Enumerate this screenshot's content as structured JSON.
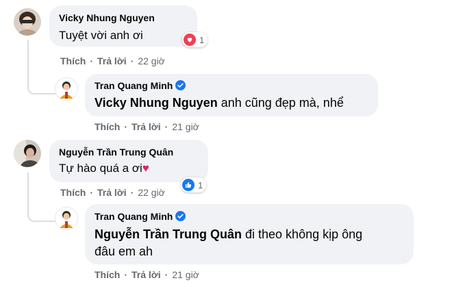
{
  "colors": {
    "bubble": "#f0f2f5",
    "meta": "#65676b",
    "verified": "#1877f2",
    "love": "#f33e58",
    "like": "#1877f2"
  },
  "comments": [
    {
      "author": "Vicky Nhung Nguyen",
      "text": "Tuyệt vời anh ơi",
      "reaction": {
        "icon": "heart-icon",
        "count": "1"
      },
      "actions": {
        "like": "Thích",
        "reply": "Trả lời",
        "time": "22 giờ"
      }
    },
    {
      "author": "Tran Quang Minh",
      "verified": true,
      "mention": "Vicky Nhung Nguyen",
      "text": " anh cũng đẹp mà, nhể",
      "actions": {
        "like": "Thích",
        "reply": "Trả lời",
        "time": "21 giờ"
      }
    },
    {
      "author": "Nguyễn Trần Trung Quân",
      "text": "Tự hào quá a ơi",
      "text_emoji": "♥",
      "reaction": {
        "icon": "thumbs-up-icon",
        "count": "1"
      },
      "actions": {
        "like": "Thích",
        "reply": "Trả lời",
        "time": "22 giờ"
      }
    },
    {
      "author": "Tran Quang Minh",
      "verified": true,
      "mention": "Nguyễn Trần Trung Quân",
      "text_line1": " đi theo không kịp ông",
      "text_line2": "đâu em ah",
      "actions": {
        "like": "Thích",
        "reply": "Trả lời",
        "time": "21 giờ"
      }
    }
  ]
}
